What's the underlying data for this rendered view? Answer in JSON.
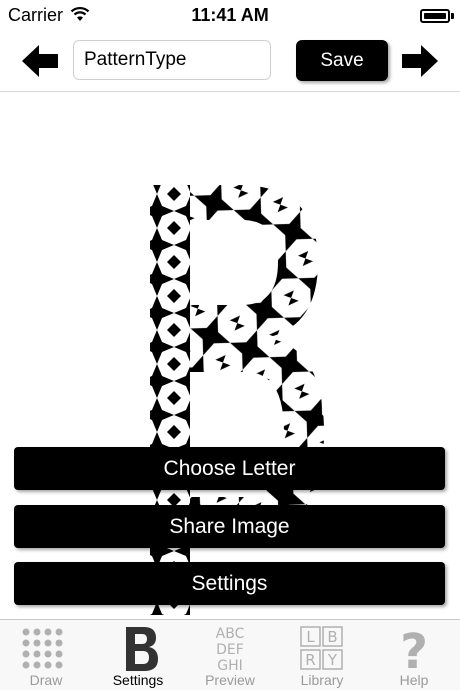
{
  "status_bar": {
    "carrier": "Carrier",
    "time": "11:41 AM",
    "battery_level": 1.0
  },
  "toolbar": {
    "title_value": "PatternType",
    "save_label": "Save",
    "prev_icon": "arrow-left-icon",
    "next_icon": "arrow-right-icon"
  },
  "canvas": {
    "letter": "B",
    "pattern": "black star tile pattern"
  },
  "actions": {
    "choose_letter": "Choose Letter",
    "share_image": "Share Image",
    "settings": "Settings"
  },
  "tabs": [
    {
      "label": "Draw",
      "icon": "dot-grid-icon",
      "active": false
    },
    {
      "label": "Settings",
      "icon": "letter-b-icon",
      "active": true
    },
    {
      "label": "Preview",
      "icon": "alphabet-icon",
      "active": false
    },
    {
      "label": "Library",
      "icon": "library-icon",
      "active": false
    },
    {
      "label": "Help",
      "icon": "question-mark-icon",
      "active": false
    }
  ],
  "colors": {
    "accent": "#000000",
    "inactive_tab": "#9a9a9a",
    "background": "#ffffff"
  }
}
